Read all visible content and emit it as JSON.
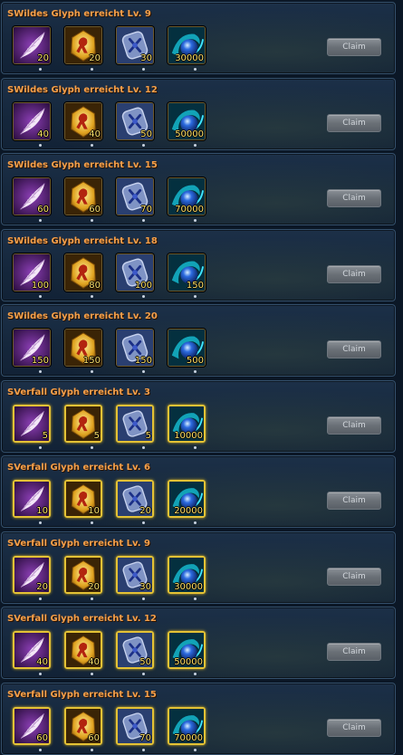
{
  "claim_label": "Claim",
  "rewards": [
    {
      "title": "SWildes Glyph erreicht Lv. 9",
      "tier": "silver",
      "items": [
        "20",
        "20",
        "30",
        "30000"
      ]
    },
    {
      "title": "SWildes Glyph erreicht Lv. 12",
      "tier": "silver",
      "items": [
        "40",
        "40",
        "50",
        "50000"
      ]
    },
    {
      "title": "SWildes Glyph erreicht Lv. 15",
      "tier": "silver",
      "items": [
        "60",
        "60",
        "70",
        "70000"
      ]
    },
    {
      "title": "SWildes Glyph erreicht Lv. 18",
      "tier": "silver",
      "items": [
        "100",
        "80",
        "100",
        "150"
      ]
    },
    {
      "title": "SWildes Glyph erreicht Lv. 20",
      "tier": "silver",
      "items": [
        "150",
        "150",
        "150",
        "500"
      ]
    },
    {
      "title": "SVerfall Glyph erreicht Lv. 3",
      "tier": "gold",
      "items": [
        "5",
        "5",
        "5",
        "10000"
      ]
    },
    {
      "title": "SVerfall Glyph erreicht Lv. 6",
      "tier": "gold",
      "items": [
        "10",
        "10",
        "20",
        "20000"
      ]
    },
    {
      "title": "SVerfall Glyph erreicht Lv. 9",
      "tier": "gold",
      "items": [
        "20",
        "20",
        "30",
        "30000"
      ]
    },
    {
      "title": "SVerfall Glyph erreicht Lv. 12",
      "tier": "gold",
      "items": [
        "40",
        "40",
        "50",
        "50000"
      ]
    },
    {
      "title": "SVerfall Glyph erreicht Lv. 15",
      "tier": "gold",
      "items": [
        "60",
        "60",
        "70",
        "70000"
      ]
    }
  ],
  "item_icons": [
    "feather-icon",
    "golden-seal-icon",
    "blue-rune-icon",
    "blue-orb-icon"
  ],
  "colors": {
    "title": "#f6a04a",
    "quantity": "#ffe26a",
    "gold_frame": "#e4c235",
    "panel": "#1c3048"
  }
}
